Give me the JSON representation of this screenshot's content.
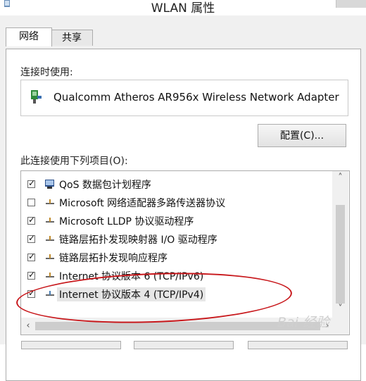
{
  "window": {
    "title": "WLAN 属性"
  },
  "tabs": [
    {
      "label": "网络",
      "active": true
    },
    {
      "label": "共享",
      "active": false
    }
  ],
  "connect_using": {
    "label": "连接时使用:",
    "adapter": "Qualcomm Atheros AR956x Wireless Network Adapter",
    "adapter_icon": "network-adapter-icon"
  },
  "configure_button": "配置(C)...",
  "items_label": "此连接使用下列项目(O):",
  "items": [
    {
      "label": "QoS 数据包计划程序",
      "checked": true,
      "icon": "qos-service-icon"
    },
    {
      "label": "Microsoft 网络适配器多路传送器协议",
      "checked": false,
      "icon": "protocol-icon"
    },
    {
      "label": "Microsoft LLDP 协议驱动程序",
      "checked": true,
      "icon": "protocol-icon"
    },
    {
      "label": "链路层拓扑发现映射器 I/O 驱动程序",
      "checked": true,
      "icon": "protocol-icon"
    },
    {
      "label": "链路层拓扑发现响应程序",
      "checked": true,
      "icon": "protocol-icon"
    },
    {
      "label": "Internet 协议版本 6 (TCP/IPv6)",
      "checked": true,
      "icon": "protocol-icon"
    },
    {
      "label": "Internet 协议版本 4 (TCP/IPv4)",
      "checked": true,
      "icon": "protocol-icon",
      "selected": true
    }
  ],
  "colors": {
    "highlight_oval": "#c8181c",
    "panel_bg": "#f0f0f0"
  },
  "watermark": "Bai 经验"
}
